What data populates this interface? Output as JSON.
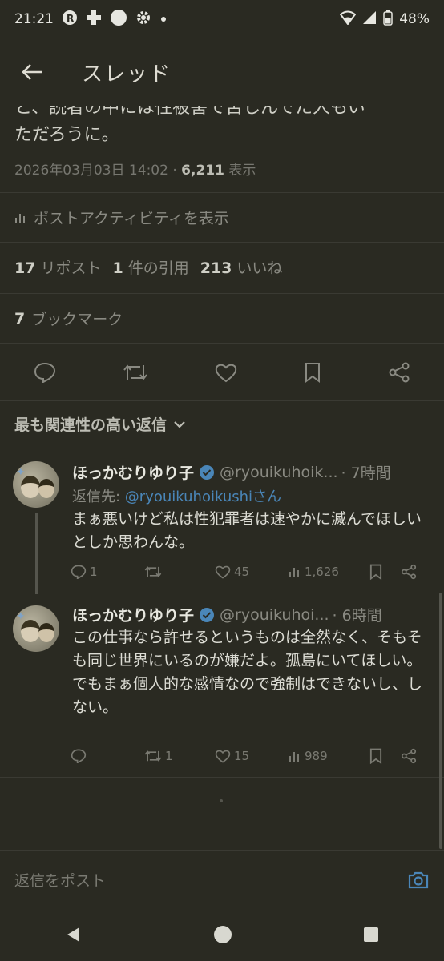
{
  "status_bar": {
    "time": "21:21",
    "battery": "48%",
    "icons": [
      "r-app-icon",
      "plus-icon",
      "circle-icon",
      "settings-icon",
      "dot-icon",
      "signal-icon",
      "battery-icon"
    ]
  },
  "header": {
    "title": "スレッド",
    "back_icon": "arrow-left-icon"
  },
  "tweet": {
    "text_tail_1": "と、読者の中には性被害で苦しんでた人もい",
    "text_tail_2": "ただろうに。",
    "timestamp": "2026年03月03日 14:02",
    "separator": " · ",
    "views": "6,211",
    "views_label": " 表示",
    "activity_label": "ポストアクティビティを表示",
    "reposts": "17",
    "reposts_label": "リポスト",
    "quotes": "1",
    "quotes_label": "件の引用",
    "likes": "213",
    "likes_label": "いいね",
    "bookmarks": "7",
    "bookmarks_label": "ブックマーク"
  },
  "sort": {
    "label": "最も関連性の高い返信"
  },
  "replies": [
    {
      "name": "ほっかむりゆり子",
      "handle": "@ryouikuhoik...",
      "time": "· 7時間",
      "reply_to_prefix": "返信先: ",
      "reply_to_user": "@ryouikuhoikushi",
      "reply_to_suffix": "さん",
      "body": "まぁ悪いけど私は性犯罪者は速やかに滅んでほしいとしか思わんな。",
      "replies_count": "1",
      "reposts_count": "",
      "likes_count": "45",
      "views_count": "1,626"
    },
    {
      "name": "ほっかむりゆり子",
      "handle": "@ryouikuhoi...",
      "time": "· 6時間",
      "body": "この仕事なら許せるというものは全然なく、そもそも同じ世界にいるのが嫌だよ。孤島にいてほしい。\nでもまぁ個人的な感情なので強制はできないし、しない。",
      "replies_count": "",
      "reposts_count": "1",
      "likes_count": "15",
      "views_count": "989"
    }
  ],
  "composer": {
    "placeholder": "返信をポスト"
  },
  "colors": {
    "background": "#2a2a22",
    "accent": "#4a86b8",
    "muted": "#8a8a82"
  }
}
